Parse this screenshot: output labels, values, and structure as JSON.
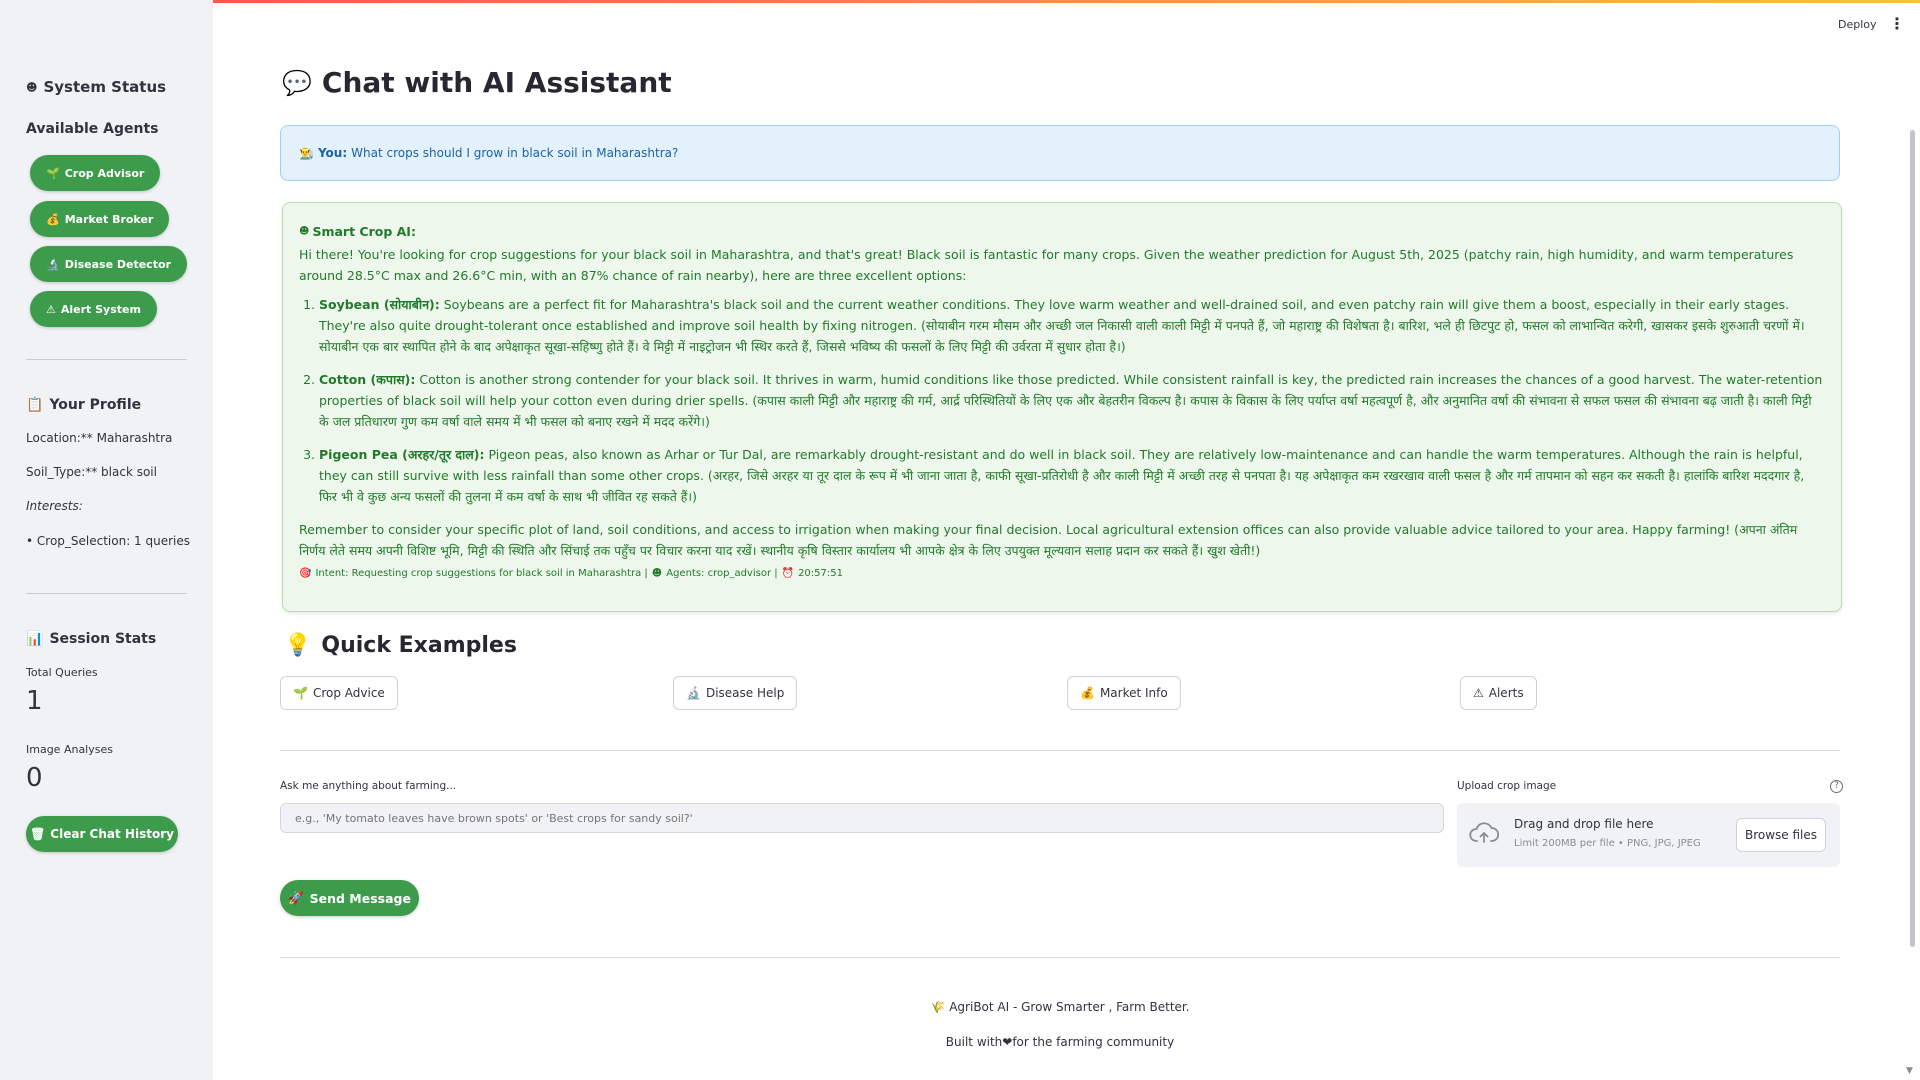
{
  "app": {
    "deploy_label": "Deploy",
    "menu_icon": "⋮"
  },
  "sidebar": {
    "system_status": {
      "icon": "☻",
      "label": "System Status"
    },
    "available_agents": "Available Agents",
    "agents": [
      {
        "icon": "🌱",
        "label": "Crop Advisor"
      },
      {
        "icon": "💰",
        "label": "Market Broker"
      },
      {
        "icon": "🔬",
        "label": "Disease Detector"
      },
      {
        "icon": "⚠",
        "label": "Alert System"
      }
    ],
    "profile": {
      "icon": "📋",
      "title": "Your Profile",
      "location": "Location:** Maharashtra",
      "soil_type": "Soil_Type:** black soil",
      "interests_label": "Interests:",
      "interest_item": "• Crop_Selection: 1 queries"
    },
    "stats": {
      "icon": "📊",
      "title": "Session Stats",
      "total_queries_label": "Total Queries",
      "total_queries_value": "1",
      "image_analyses_label": "Image Analyses",
      "image_analyses_value": "0"
    },
    "clear_button": {
      "icon": "🗑",
      "label": "Clear Chat History"
    }
  },
  "main": {
    "title_icon": "💬",
    "title": "Chat with AI Assistant",
    "user_message": {
      "icon": "👨‍🌾",
      "speaker": "You:",
      "text": "What crops should I grow in black soil in Maharashtra?"
    },
    "ai_message": {
      "icon": "☻",
      "speaker": "Smart Crop AI:",
      "intro": "Hi there! You're looking for crop suggestions for your black soil in Maharashtra, and that's great! Black soil is fantastic for many crops. Given the weather prediction for August 5th, 2025 (patchy rain, high humidity, and warm temperatures around 28.5°C max and 26.6°C min, with an 87% chance of rain nearby), here are three excellent options:",
      "items": [
        {
          "title": "Soybean (सोयाबीन):",
          "text": " Soybeans are a perfect fit for Maharashtra's black soil and the current weather conditions. They love warm weather and well-drained soil, and even patchy rain will give them a boost, especially in their early stages. They're also quite drought-tolerant once established and improve soil health by fixing nitrogen. (सोयाबीन गरम मौसम और अच्छी जल निकासी वाली काली मिट्टी में पनपते हैं, जो महाराष्ट्र की विशेषता है। बारिश, भले ही छिटपुट हो, फसल को लाभान्वित करेगी, खासकर इसके शुरुआती चरणों में। सोयाबीन एक बार स्थापित होने के बाद अपेक्षाकृत सूखा-सहिष्णु होते हैं। वे मिट्टी में नाइट्रोजन भी स्थिर करते हैं, जिससे भविष्य की फसलों के लिए मिट्टी की उर्वरता में सुधार होता है।)"
        },
        {
          "title": "Cotton (कपास):",
          "text": " Cotton is another strong contender for your black soil. It thrives in warm, humid conditions like those predicted. While consistent rainfall is key, the predicted rain increases the chances of a good harvest. The water-retention properties of black soil will help your cotton even during drier spells. (कपास काली मिट्टी और महाराष्ट्र की गर्म, आर्द्र परिस्थितियों के लिए एक और बेहतरीन विकल्प है। कपास के विकास के लिए पर्याप्त वर्षा महत्वपूर्ण है, और अनुमानित वर्षा की संभावना से सफल फसल की संभावना बढ़ जाती है। काली मिट्टी के जल प्रतिधारण गुण कम वर्षा वाले समय में भी फसल को बनाए रखने में मदद करेंगे।)"
        },
        {
          "title": "Pigeon Pea (अरहर/तूर दाल):",
          "text": " Pigeon peas, also known as Arhar or Tur Dal, are remarkably drought-resistant and do well in black soil. They are relatively low-maintenance and can handle the warm temperatures. Although the rain is helpful, they can still survive with less rainfall than some other crops. (अरहर, जिसे अरहर या तूर दाल के रूप में भी जाना जाता है, काफी सूखा-प्रतिरोधी है और काली मिट्टी में अच्छी तरह से पनपता है। यह अपेक्षाकृत कम रखरखाव वाली फसल है और गर्म तापमान को सहन कर सकती है। हालांकि बारिश मददगार है, फिर भी वे कुछ अन्य फसलों की तुलना में कम वर्षा के साथ भी जीवित रह सकते हैं।)"
        }
      ],
      "closing": "Remember to consider your specific plot of land, soil conditions, and access to irrigation when making your final decision. Local agricultural extension offices can also provide valuable advice tailored to your area. Happy farming! (अपना अंतिम निर्णय लेते समय अपनी विशिष्ट भूमि, मिट्टी की स्थिति और सिंचाई तक पहुँच पर विचार करना याद रखें। स्थानीय कृषि विस्तार कार्यालय भी आपके क्षेत्र के लिए उपयुक्त मूल्यवान सलाह प्रदान कर सकते हैं। खुश खेती!)",
      "meta": {
        "intent_icon": "🎯",
        "intent": "Intent: Requesting crop suggestions for black soil in Maharashtra |",
        "agents_icon": "☻",
        "agents": "Agents: crop_advisor |",
        "time_icon": "⏰",
        "time": "20:57:51"
      }
    },
    "quick_examples": {
      "icon": "💡",
      "title": "Quick Examples",
      "buttons": [
        {
          "icon": "🌱",
          "label": "Crop Advice"
        },
        {
          "icon": "🔬",
          "label": "Disease Help"
        },
        {
          "icon": "💰",
          "label": "Market Info"
        },
        {
          "icon": "⚠",
          "label": "Alerts"
        }
      ]
    },
    "chat_input": {
      "label": "Ask me anything about farming...",
      "placeholder": "e.g., 'My tomato leaves have brown spots' or 'Best crops for sandy soil?'",
      "value": ""
    },
    "upload": {
      "label": "Upload crop image",
      "help_icon": "?",
      "drop_text": "Drag and drop file here",
      "limit_text": "Limit 200MB per file • PNG, JPG, JPEG",
      "browse_label": "Browse files"
    },
    "send_button": {
      "icon": "🚀",
      "label": "Send Message"
    },
    "footer": {
      "line1_icon": "🌾",
      "line1": "AgriBot AI - Grow Smarter , Farm Better.",
      "line2": "Built with❤for the farming community"
    }
  },
  "colors": {
    "accent_green": "#3d9c4c",
    "ai_bg": "#eef7ec",
    "ai_text": "#217a2b",
    "user_bg": "#e3f1fc",
    "user_text": "#1a63a8",
    "sidebar_bg": "#f0f2f6"
  }
}
